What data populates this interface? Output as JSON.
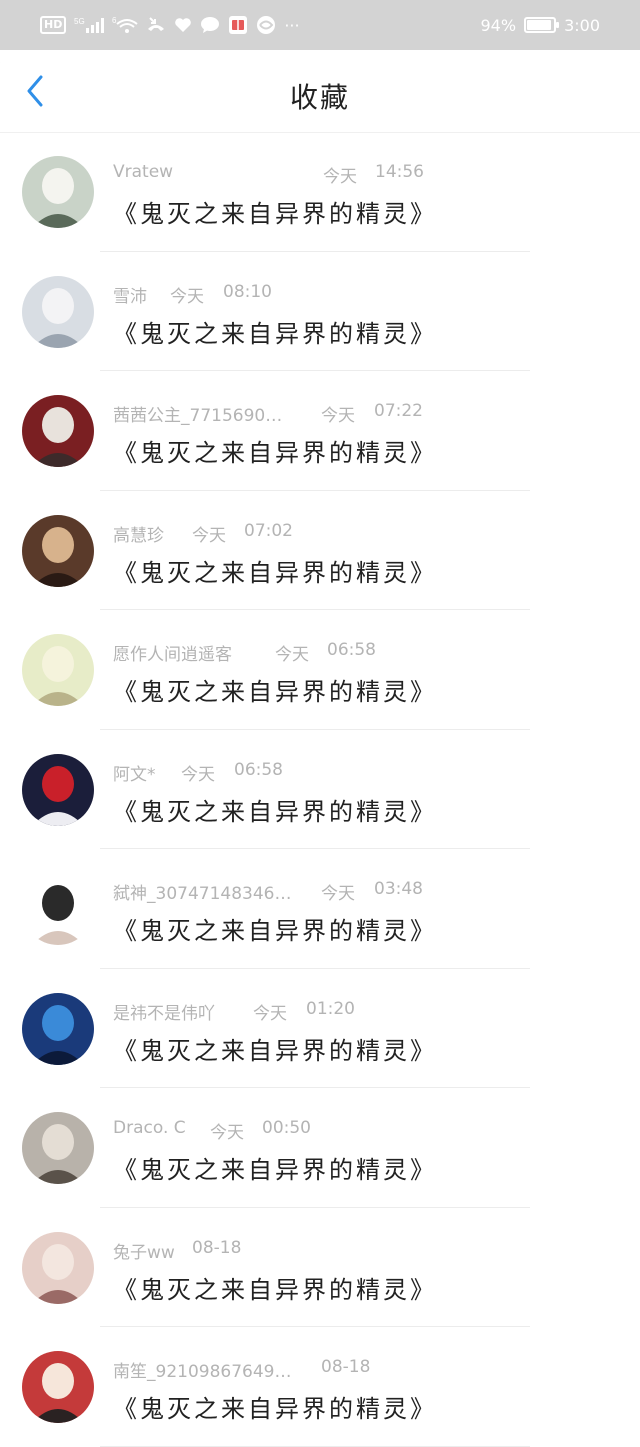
{
  "status_bar": {
    "hd": "HD",
    "net": "5G",
    "wifi_sup": "6",
    "battery_percent": "94%",
    "battery_level": 0.94,
    "time": "3:00",
    "more": "···"
  },
  "header": {
    "title": "收藏"
  },
  "items": [
    {
      "name": "Vratew",
      "day": "今天",
      "time": "14:56",
      "title": "《鬼灭之来自异界的精灵》"
    },
    {
      "name": "雪沛",
      "day": "今天",
      "time": "08:10",
      "title": "《鬼灭之来自异界的精灵》"
    },
    {
      "name": "茜茜公主_7715690…",
      "day": "今天",
      "time": "07:22",
      "title": "《鬼灭之来自异界的精灵》"
    },
    {
      "name": "高慧珍",
      "day": "今天",
      "time": "07:02",
      "title": "《鬼灭之来自异界的精灵》"
    },
    {
      "name": "愿作人间逍遥客",
      "day": "今天",
      "time": "06:58",
      "title": "《鬼灭之来自异界的精灵》"
    },
    {
      "name": "阿文*",
      "day": "今天",
      "time": "06:58",
      "title": "《鬼灭之来自异界的精灵》"
    },
    {
      "name": "弑神_30747148346…",
      "day": "今天",
      "time": "03:48",
      "title": "《鬼灭之来自异界的精灵》"
    },
    {
      "name": "是祎不是伟吖",
      "day": "今天",
      "time": "01:20",
      "title": "《鬼灭之来自异界的精灵》"
    },
    {
      "name": "Draco. C",
      "day": "今天",
      "time": "00:50",
      "title": "《鬼灭之来自异界的精灵》"
    },
    {
      "name": "兔子ww",
      "day": "",
      "time": "08-18",
      "title": "《鬼灭之来自异界的精灵》"
    },
    {
      "name": "南笙_92109867649…",
      "day": "",
      "time": "08-18",
      "title": "《鬼灭之来自异界的精灵》"
    }
  ],
  "colors": {
    "accent": "#2f8fe8",
    "status_bar_bg": "#d3d3d3",
    "meta_text": "#b4b4b4"
  }
}
